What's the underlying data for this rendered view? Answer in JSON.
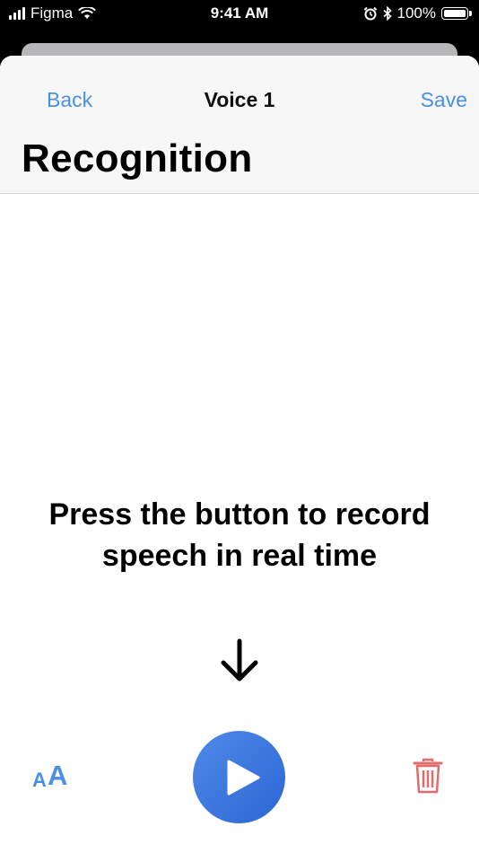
{
  "status_bar": {
    "carrier": "Figma",
    "time": "9:41 AM",
    "battery_percent": "100%",
    "battery_level": 1.0,
    "icons": [
      "signal-icon",
      "wifi-icon",
      "alarm-icon",
      "bluetooth-icon",
      "battery-icon"
    ]
  },
  "nav": {
    "back_label": "Back",
    "title": "Voice 1",
    "save_label": "Save"
  },
  "page": {
    "title": "Recognition",
    "instruction": "Press the button to record\nspeech in real time"
  },
  "toolbar": {
    "text_size_small": "A",
    "text_size_big": "A",
    "play_icon": "play-icon",
    "trash_icon": "trash-icon",
    "arrow_icon": "arrow-down-icon"
  },
  "colors": {
    "accent": "#4a90e2",
    "play_button": "#3a74dc",
    "trash": "#e26b6b",
    "header_bg": "#f7f7f7"
  }
}
